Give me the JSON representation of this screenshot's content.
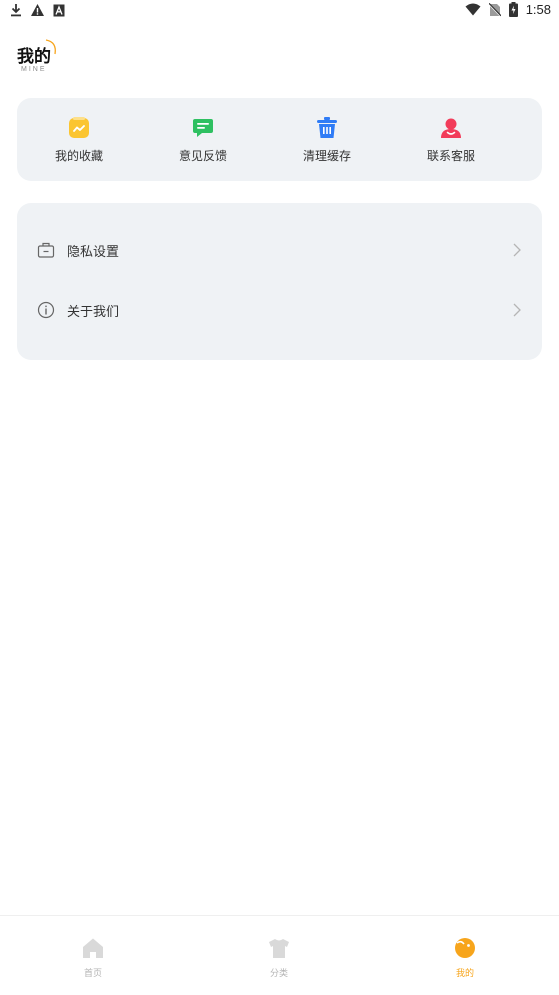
{
  "status_bar": {
    "time": "1:58",
    "left_icons": [
      "download-icon",
      "warning-icon",
      "a-badge-icon"
    ],
    "right_icons": [
      "wifi-icon",
      "no-sim-icon",
      "battery-charging-icon"
    ]
  },
  "header": {
    "title": "我的",
    "subtitle": "MINE"
  },
  "quick_actions": [
    {
      "label": "我的收藏",
      "icon": "favorites-icon",
      "color": "#fbc531"
    },
    {
      "label": "意见反馈",
      "icon": "feedback-icon",
      "color": "#2ec061"
    },
    {
      "label": "清理缓存",
      "icon": "trash-icon",
      "color": "#2f7cf6"
    },
    {
      "label": "联系客服",
      "icon": "customer-service-icon",
      "color": "#f23c5a"
    }
  ],
  "menu": [
    {
      "label": "隐私设置",
      "icon": "privacy-briefcase-icon"
    },
    {
      "label": "关于我们",
      "icon": "info-icon"
    }
  ],
  "bottom_nav": {
    "items": [
      {
        "label": "首页",
        "icon": "home-icon",
        "active": false
      },
      {
        "label": "分类",
        "icon": "category-shirt-icon",
        "active": false
      },
      {
        "label": "我的",
        "icon": "mine-icon",
        "active": true
      }
    ],
    "active_color": "#f7a51c",
    "inactive_color": "#d9d9d9"
  }
}
